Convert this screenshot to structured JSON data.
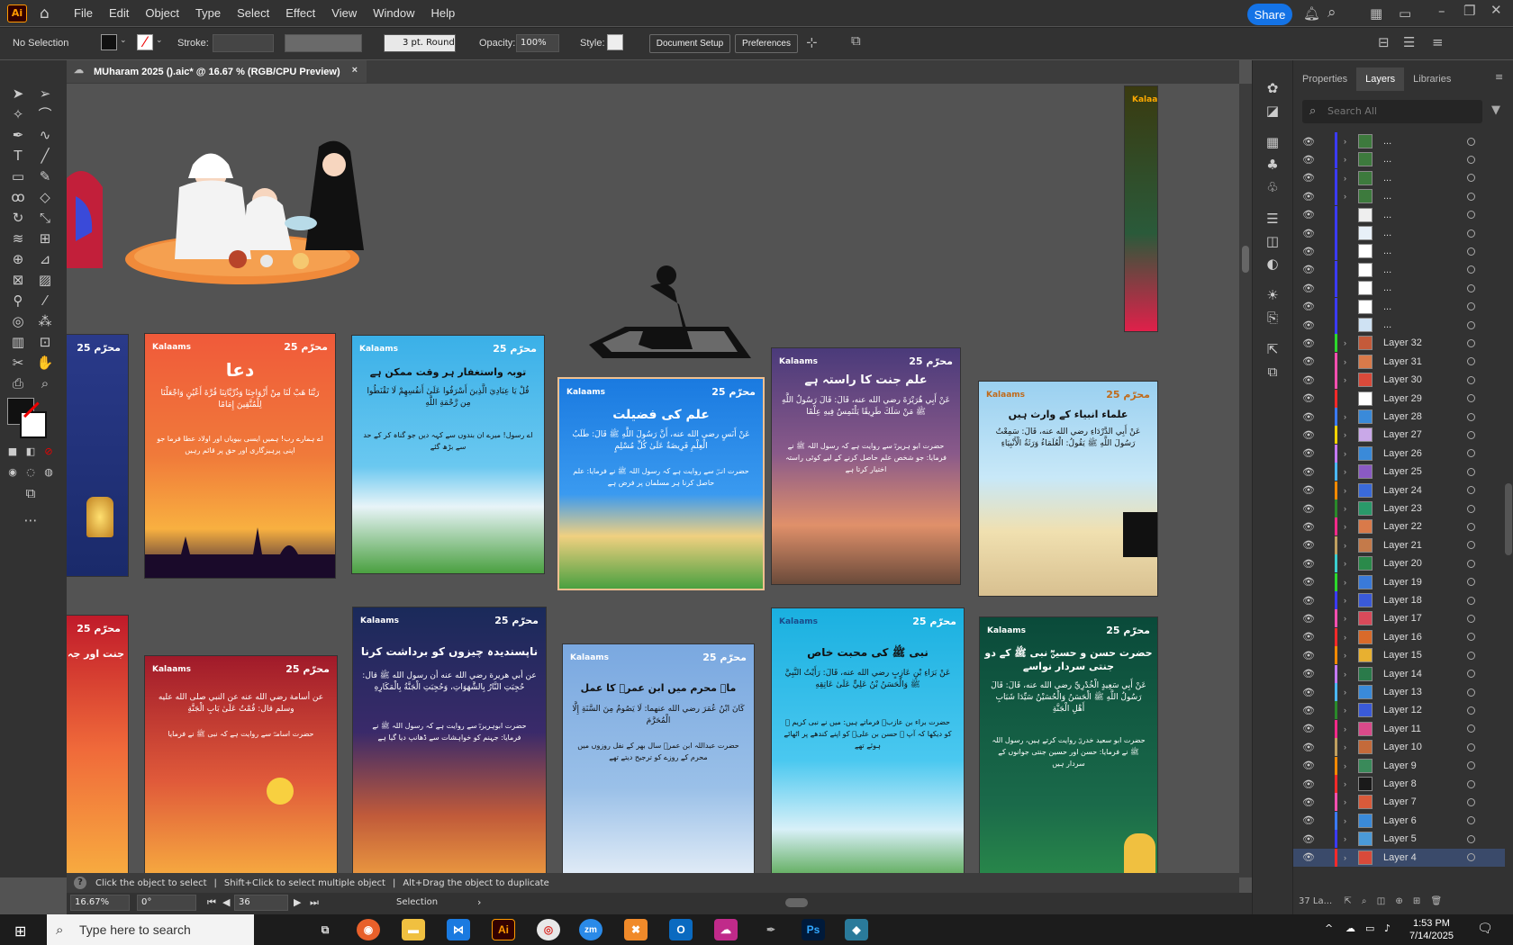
{
  "app": {
    "logo": "Ai",
    "menu": [
      "File",
      "Edit",
      "Object",
      "Type",
      "Select",
      "Effect",
      "View",
      "Window",
      "Help"
    ],
    "share": "Share"
  },
  "control": {
    "selection": "No Selection",
    "stroke_label": "Stroke:",
    "brush": "3 pt. Round",
    "opacity_label": "Opacity:",
    "opacity": "100%",
    "style_label": "Style:",
    "doc_setup": "Document Setup",
    "preferences": "Preferences"
  },
  "document": {
    "tab_title": "MUharam 2025 ().aic* @ 16.67 % (RGB/CPU Preview)",
    "close": "×"
  },
  "status": {
    "hint": "Click the object to select",
    "hint2": "Shift+Click to select multiple object",
    "hint3": "Alt+Drag the object to duplicate",
    "zoom": "16.67%",
    "rotation": "0°",
    "artboard": "36",
    "mode": "Selection"
  },
  "panel": {
    "tabs": [
      "Properties",
      "Layers",
      "Libraries"
    ],
    "active": "Layers",
    "search_placeholder": "Search All",
    "footer": "37 La..."
  },
  "layers": [
    {
      "name": "...",
      "color": "#3a3aff",
      "arrow": "›",
      "thumb": "#3d7a3d"
    },
    {
      "name": "...",
      "color": "#3a3aff",
      "arrow": "›",
      "thumb": "#3d7a3d"
    },
    {
      "name": "...",
      "color": "#3a3aff",
      "arrow": "›",
      "thumb": "#3d7a3d"
    },
    {
      "name": "...",
      "color": "#3a3aff",
      "arrow": "›",
      "thumb": "#3d7a3d"
    },
    {
      "name": "...",
      "color": "#3a3aff",
      "arrow": "",
      "thumb": "#eeeeee"
    },
    {
      "name": "...",
      "color": "#3a3aff",
      "arrow": "",
      "thumb": "#e8f0f8"
    },
    {
      "name": "...",
      "color": "#3a3aff",
      "arrow": "",
      "thumb": "#ffffff"
    },
    {
      "name": "...",
      "color": "#3a3aff",
      "arrow": "",
      "thumb": "#ffffff"
    },
    {
      "name": "...",
      "color": "#3a3aff",
      "arrow": "",
      "thumb": "#ffffff"
    },
    {
      "name": "...",
      "color": "#3a3aff",
      "arrow": "",
      "thumb": "#ffffff"
    },
    {
      "name": "...",
      "color": "#3a3aff",
      "arrow": "",
      "thumb": "#cfe2f3"
    },
    {
      "name": "Layer 32",
      "color": "#2bd92b",
      "arrow": "›",
      "thumb": "#c45a3a"
    },
    {
      "name": "Layer 31",
      "color": "#ff4fb0",
      "arrow": "›",
      "thumb": "#d97a4a"
    },
    {
      "name": "Layer 30",
      "color": "#ff4fb0",
      "arrow": "›",
      "thumb": "#d94a3a"
    },
    {
      "name": "Layer 29",
      "color": "#ff2a2a",
      "arrow": "",
      "thumb": "#ffffff"
    },
    {
      "name": "Layer 28",
      "color": "#3a7aff",
      "arrow": "›",
      "thumb": "#3a8ad9"
    },
    {
      "name": "Layer 27",
      "color": "#ffd400",
      "arrow": "›",
      "thumb": "#c9a8e8"
    },
    {
      "name": "Layer 26",
      "color": "#c57aff",
      "arrow": "›",
      "thumb": "#3a8ad9"
    },
    {
      "name": "Layer 25",
      "color": "#4ab8ff",
      "arrow": "›",
      "thumb": "#8a5ac4"
    },
    {
      "name": "Layer 24",
      "color": "#ff8a00",
      "arrow": "›",
      "thumb": "#3a6ad9"
    },
    {
      "name": "Layer 23",
      "color": "#2a8a2a",
      "arrow": "›",
      "thumb": "#2a9a6a"
    },
    {
      "name": "Layer 22",
      "color": "#ff2a8a",
      "arrow": "›",
      "thumb": "#d97a4a"
    },
    {
      "name": "Layer 21",
      "color": "#c0a060",
      "arrow": "›",
      "thumb": "#c47a4a"
    },
    {
      "name": "Layer 20",
      "color": "#3acfcf",
      "arrow": "›",
      "thumb": "#2a8a4a"
    },
    {
      "name": "Layer 19",
      "color": "#2bd92b",
      "arrow": "›",
      "thumb": "#3a7ad9"
    },
    {
      "name": "Layer 18",
      "color": "#3a3aff",
      "arrow": "›",
      "thumb": "#3a5ad9"
    },
    {
      "name": "Layer 17",
      "color": "#ff4fb0",
      "arrow": "›",
      "thumb": "#d94a5a"
    },
    {
      "name": "Layer 16",
      "color": "#ff2a2a",
      "arrow": "›",
      "thumb": "#d96a2a"
    },
    {
      "name": "Layer 15",
      "color": "#ff8a00",
      "arrow": "›",
      "thumb": "#e8b030"
    },
    {
      "name": "Layer 14",
      "color": "#c57aff",
      "arrow": "›",
      "thumb": "#2a7a4a"
    },
    {
      "name": "Layer 13",
      "color": "#4ab8ff",
      "arrow": "›",
      "thumb": "#3a8ad9"
    },
    {
      "name": "Layer 12",
      "color": "#2a8a2a",
      "arrow": "›",
      "thumb": "#3a5ad9"
    },
    {
      "name": "Layer 11",
      "color": "#ff2a8a",
      "arrow": "›",
      "thumb": "#d94a8a"
    },
    {
      "name": "Layer 10",
      "color": "#c0a060",
      "arrow": "›",
      "thumb": "#c46a3a"
    },
    {
      "name": "Layer 9",
      "color": "#ff8a00",
      "arrow": "›",
      "thumb": "#3a8a5a"
    },
    {
      "name": "Layer 8",
      "color": "#ff2a2a",
      "arrow": "›",
      "thumb": "#1a1a1a"
    },
    {
      "name": "Layer 7",
      "color": "#ff4fb0",
      "arrow": "›",
      "thumb": "#d95a3a"
    },
    {
      "name": "Layer 6",
      "color": "#3a7aff",
      "arrow": "›",
      "thumb": "#3a8ad9"
    },
    {
      "name": "Layer 5",
      "color": "#3a3aff",
      "arrow": "›",
      "thumb": "#4a9ad9"
    },
    {
      "name": "Layer 4",
      "color": "#ff2a2a",
      "arrow": "›",
      "thumb": "#d94a3a"
    }
  ],
  "taskbar": {
    "search_placeholder": "Type here to search",
    "time": "1:53 PM",
    "date": "7/14/2025"
  },
  "posters": {
    "dua_title": "دعا",
    "tawba_title": "توبہ واستغفار ہر وقت ممکن ہے",
    "ilm_title": "علم کی فضیلت",
    "jannat_title": "علم جنت کا راستہ ہے",
    "anbiya_title": "علماء انبیاء کے وارث ہیں",
    "napasandeeda_title": "ناپسندیدہ چیزوں کو برداشت کرنا",
    "muharram_title": "ماہ محرم میں ابن عمرؓ کا عمل",
    "mohabbat_title": "نبی ﷺ کی محبت خاص",
    "hasan_title": "حضرت حسن و حسینؓ نبی ﷺ کے دو جنتی سردار نواسے",
    "jannat_left_title": "جنت اور جہ",
    "kalaams": "Kalaams",
    "badge": "محرّم 25"
  }
}
